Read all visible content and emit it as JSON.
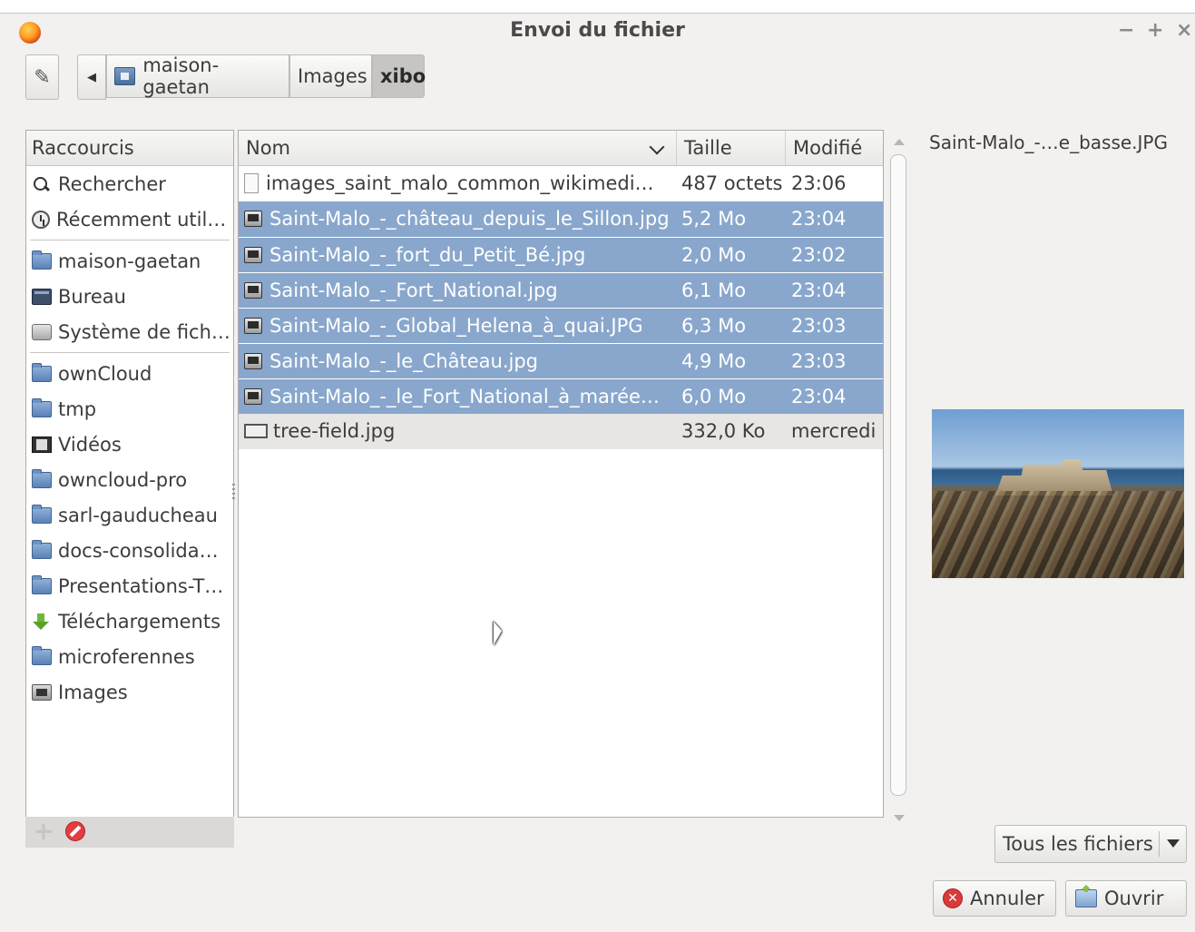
{
  "window": {
    "title": "Envoi du fichier",
    "controls": {
      "minimize": "−",
      "maximize": "+",
      "close": "×"
    }
  },
  "toolbar": {
    "breadcrumbs": [
      "maison-gaetan",
      "Images",
      "xibo"
    ],
    "active_crumb": "xibo",
    "back_arrow": "◀"
  },
  "sidebar": {
    "header": "Raccourcis",
    "groups": [
      [
        {
          "label": "Rechercher",
          "icon": "search-icon"
        },
        {
          "label": "Récemment util…",
          "icon": "clock-icon"
        }
      ],
      [
        {
          "label": "maison-gaetan",
          "icon": "home-folder-icon"
        },
        {
          "label": "Bureau",
          "icon": "desktop-icon"
        },
        {
          "label": "Système de fich…",
          "icon": "disk-icon"
        }
      ],
      [
        {
          "label": "ownCloud",
          "icon": "folder-icon"
        },
        {
          "label": "tmp",
          "icon": "folder-icon"
        },
        {
          "label": "Vidéos",
          "icon": "film-icon"
        },
        {
          "label": "owncloud-pro",
          "icon": "folder-icon"
        },
        {
          "label": "sarl-gauducheau",
          "icon": "folder-icon"
        },
        {
          "label": "docs-consolida…",
          "icon": "folder-icon"
        },
        {
          "label": "Presentations-T…",
          "icon": "folder-icon"
        },
        {
          "label": "Téléchargements",
          "icon": "download-icon"
        },
        {
          "label": "microferennes",
          "icon": "folder-icon"
        },
        {
          "label": "Images",
          "icon": "pictures-icon"
        }
      ]
    ]
  },
  "filelist": {
    "columns": {
      "name": "Nom",
      "size": "Taille",
      "modified": "Modifié"
    },
    "rows": [
      {
        "name": "images_saint_malo_common_wikimedi…",
        "size": "487 octets",
        "modified": "23:06",
        "selected": false,
        "icon": "text-file-icon"
      },
      {
        "name": "Saint-Malo_-_château_depuis_le_Sillon.jpg",
        "size": "5,2 Mo",
        "modified": "23:04",
        "selected": true,
        "icon": "image-file-icon"
      },
      {
        "name": "Saint-Malo_-_fort_du_Petit_Bé.jpg",
        "size": "2,0 Mo",
        "modified": "23:02",
        "selected": true,
        "icon": "image-file-icon"
      },
      {
        "name": "Saint-Malo_-_Fort_National.jpg",
        "size": "6,1 Mo",
        "modified": "23:04",
        "selected": true,
        "icon": "image-file-icon"
      },
      {
        "name": "Saint-Malo_-_Global_Helena_à_quai.JPG",
        "size": "6,3 Mo",
        "modified": "23:03",
        "selected": true,
        "icon": "image-file-icon"
      },
      {
        "name": "Saint-Malo_-_le_Château.jpg",
        "size": "4,9 Mo",
        "modified": "23:03",
        "selected": true,
        "icon": "image-file-icon"
      },
      {
        "name": "Saint-Malo_-_le_Fort_National_à_marée…",
        "size": "6,0 Mo",
        "modified": "23:04",
        "selected": true,
        "icon": "image-file-icon"
      },
      {
        "name": "tree-field.jpg",
        "size": "332,0 Ko",
        "modified": "mercredi",
        "selected": false,
        "hover": true,
        "icon": "picture-file-icon"
      }
    ]
  },
  "preview": {
    "filename": "Saint-Malo_-…e_basse.JPG"
  },
  "filter": {
    "selected": "Tous les fichiers"
  },
  "buttons": {
    "cancel": "Annuler",
    "open": "Ouvrir"
  },
  "colors": {
    "selection": "#89a7cc",
    "window_bg": "#f2f1f0"
  }
}
